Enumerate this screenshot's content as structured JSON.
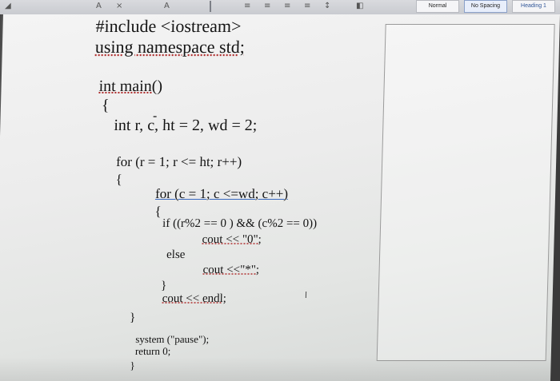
{
  "toolbar": {
    "styles": [
      "Normal",
      "No Spacing",
      "Heading 1"
    ],
    "active_style": "No Spacing"
  },
  "document": {
    "lines": [
      "#include <iostream>",
      "using namespace std;",
      "int main()",
      "{",
      "int r, c, ht = 2, wd = 2;",
      "for (r = 1; r <= ht; r++)",
      "{",
      "for (c = 1; c <=wd; c++)",
      "{",
      "if ((r%2 == 0 ) && (c%2 == 0))",
      "cout << \"0\";",
      "else",
      "cout <<\"*\";",
      "}",
      "cout << endl;",
      "}",
      "system (\"pause\");",
      "return 0;",
      "}"
    ]
  },
  "cursor_glyph": "I"
}
